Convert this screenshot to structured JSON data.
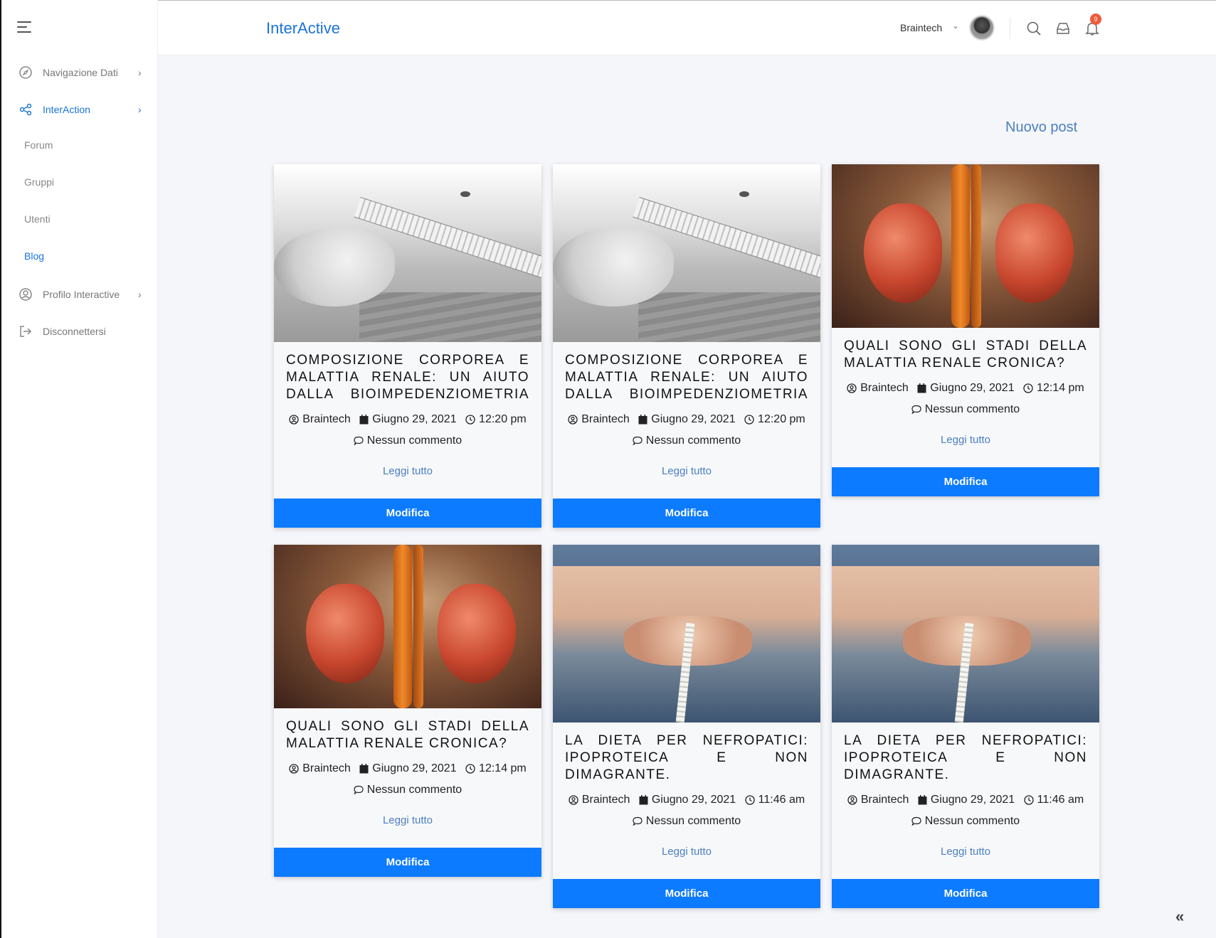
{
  "sidebar": {
    "items": [
      {
        "label": "Navigazione Dati",
        "icon": "compass-icon"
      },
      {
        "label": "InterAction",
        "icon": "share-icon"
      },
      {
        "label": "Profilo Interactive",
        "icon": "user-circle-icon"
      },
      {
        "label": "Disconnettersi",
        "icon": "logout-icon"
      }
    ],
    "subitems": [
      "Forum",
      "Gruppi",
      "Utenti",
      "Blog"
    ]
  },
  "header": {
    "brand": "InterActive",
    "user": "Braintech",
    "notifications_count": "9"
  },
  "main": {
    "new_post": "Nuovo post",
    "posts": [
      {
        "title": "COMPOSIZIONE CORPOREA E MALATTIA RENALE: UN AIUTO DALLA BIOIMPEDENZIOMETRIA",
        "author": "Braintech",
        "date": "Giugno 29, 2021",
        "time": "12:20 pm",
        "comments": "Nessun commento",
        "read_more": "Leggi tutto",
        "edit": "Modifica",
        "image": "measuring-tape-waist"
      },
      {
        "title": "COMPOSIZIONE CORPOREA E MALATTIA RENALE: UN AIUTO DALLA BIOIMPEDENZIOMETRIA",
        "author": "Braintech",
        "date": "Giugno 29, 2021",
        "time": "12:20 pm",
        "comments": "Nessun commento",
        "read_more": "Leggi tutto",
        "edit": "Modifica",
        "image": "measuring-tape-waist"
      },
      {
        "title": "QUALI SONO GLI STADI DELLA MALATTIA RENALE CRONICA?",
        "author": "Braintech",
        "date": "Giugno 29, 2021",
        "time": "12:14 pm",
        "comments": "Nessun commento",
        "read_more": "Leggi tutto",
        "edit": "Modifica",
        "image": "kidneys"
      },
      {
        "title": "QUALI SONO GLI STADI DELLA MALATTIA RENALE CRONICA?",
        "author": "Braintech",
        "date": "Giugno 29, 2021",
        "time": "12:14 pm",
        "comments": "Nessun commento",
        "read_more": "Leggi tutto",
        "edit": "Modifica",
        "image": "kidneys"
      },
      {
        "title": "LA DIETA PER NEFROPATICI: IPOPROTEICA E NON DIMAGRANTE.",
        "author": "Braintech",
        "date": "Giugno 29, 2021",
        "time": "11:46 am",
        "comments": "Nessun commento",
        "read_more": "Leggi tutto",
        "edit": "Modifica",
        "image": "belly-tape"
      },
      {
        "title": "LA DIETA PER NEFROPATICI: IPOPROTEICA E NON DIMAGRANTE.",
        "author": "Braintech",
        "date": "Giugno 29, 2021",
        "time": "11:46 am",
        "comments": "Nessun commento",
        "read_more": "Leggi tutto",
        "edit": "Modifica",
        "image": "belly-tape"
      }
    ]
  },
  "colors": {
    "accent": "#1a73d9",
    "button": "#0d7bff",
    "badge": "#f05a3a"
  }
}
